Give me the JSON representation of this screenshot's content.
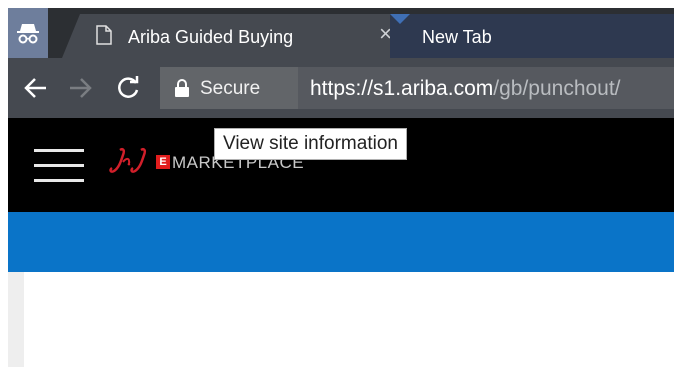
{
  "browser": {
    "tabs": [
      {
        "title": "Ariba Guided Buying",
        "active": true
      },
      {
        "title": "New Tab",
        "active": false
      }
    ],
    "close_glyph": "×",
    "incognito_icon": "incognito-icon",
    "security_label": "Secure",
    "url_host": "https://s1.ariba.com",
    "url_path": "/gb/punchout/",
    "tooltip": "View site information"
  },
  "site": {
    "brand_badge": "E",
    "brand_word": "MARKETPLACE",
    "colors": {
      "header": "#000000",
      "band": "#0a74c8",
      "brand_red": "#e21d1d"
    }
  }
}
